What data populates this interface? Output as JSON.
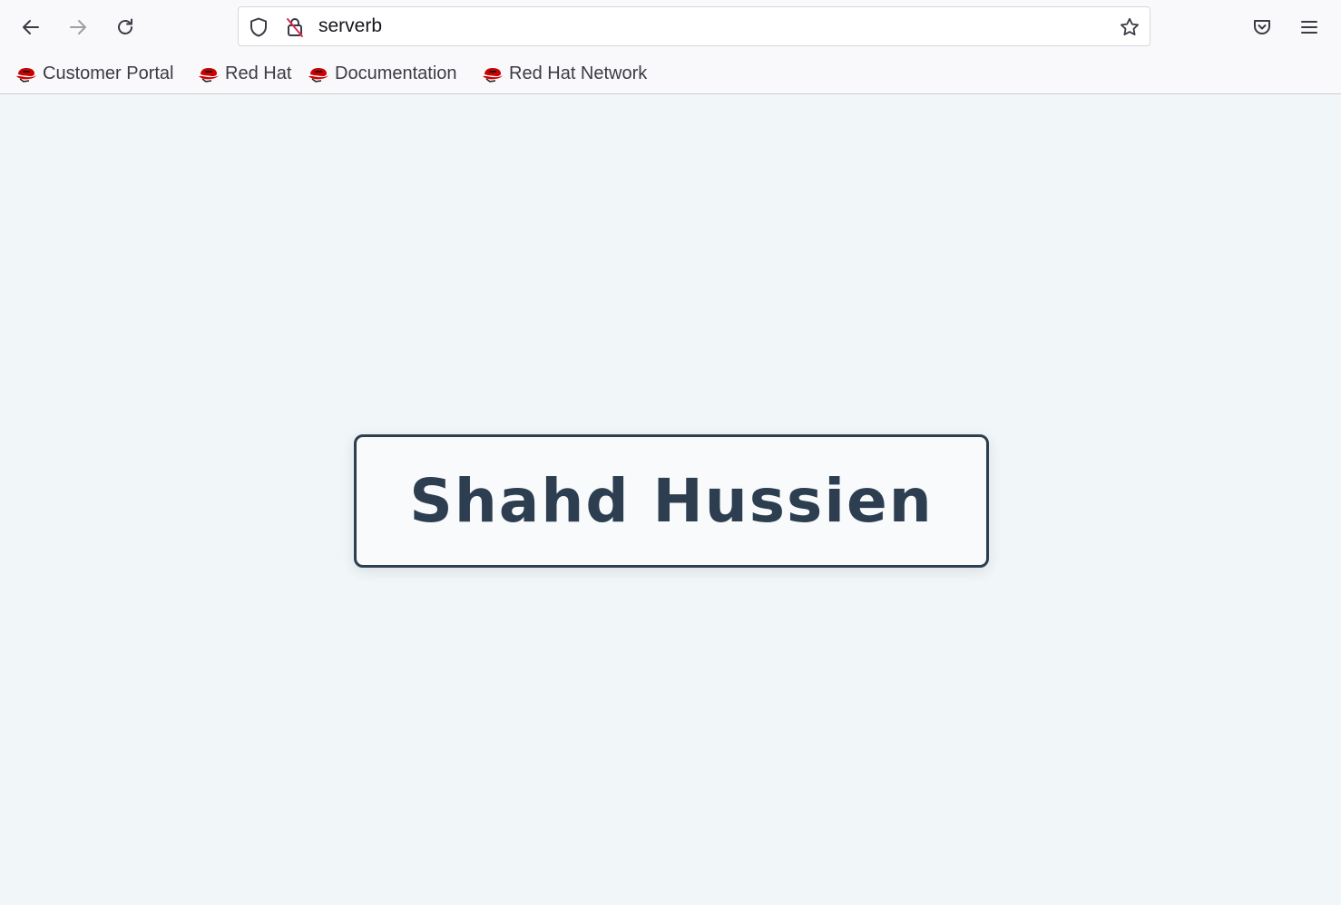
{
  "browser": {
    "url": "serverb",
    "icons": {
      "back": "arrow-left-icon",
      "forward": "arrow-right-icon",
      "reload": "reload-icon",
      "tracking": "shield-icon",
      "insecure": "lock-slash-icon",
      "bookmark_star": "star-icon",
      "pocket": "pocket-icon",
      "menu": "hamburger-menu-icon"
    }
  },
  "bookmarks": [
    {
      "label": "Customer Portal"
    },
    {
      "label": "Red Hat"
    },
    {
      "label": "Documentation"
    },
    {
      "label": "Red Hat Network"
    }
  ],
  "page": {
    "name": "Shahd Hussien"
  },
  "colors": {
    "page_background": "#f1f6f8",
    "card_border": "#2c3e50",
    "card_text": "#2c3e50",
    "redhat_red": "#cc0000"
  }
}
